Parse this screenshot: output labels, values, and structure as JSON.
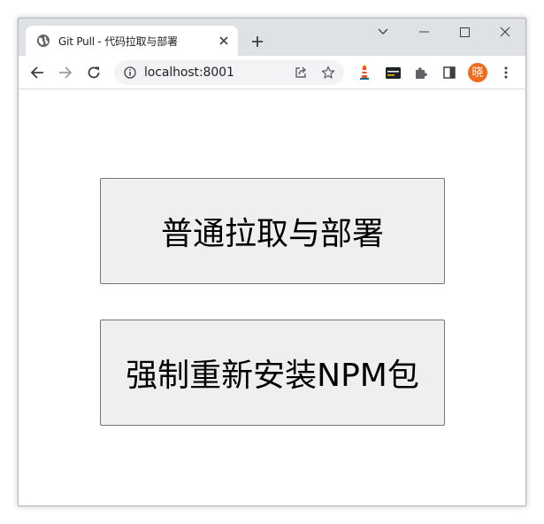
{
  "tab": {
    "title": "Git Pull - 代码拉取与部署"
  },
  "address_bar": {
    "url": "localhost:8001"
  },
  "buttons": {
    "normal_pull": "普通拉取与部署",
    "force_npm": "强制重新安装NPM包"
  },
  "icons": {
    "favicon": "globe-icon",
    "profile_avatar_char": "晓"
  },
  "colors": {
    "tabstrip": "#dee1e6",
    "button_bg": "#efefef",
    "avatar": "#f26b1d"
  }
}
